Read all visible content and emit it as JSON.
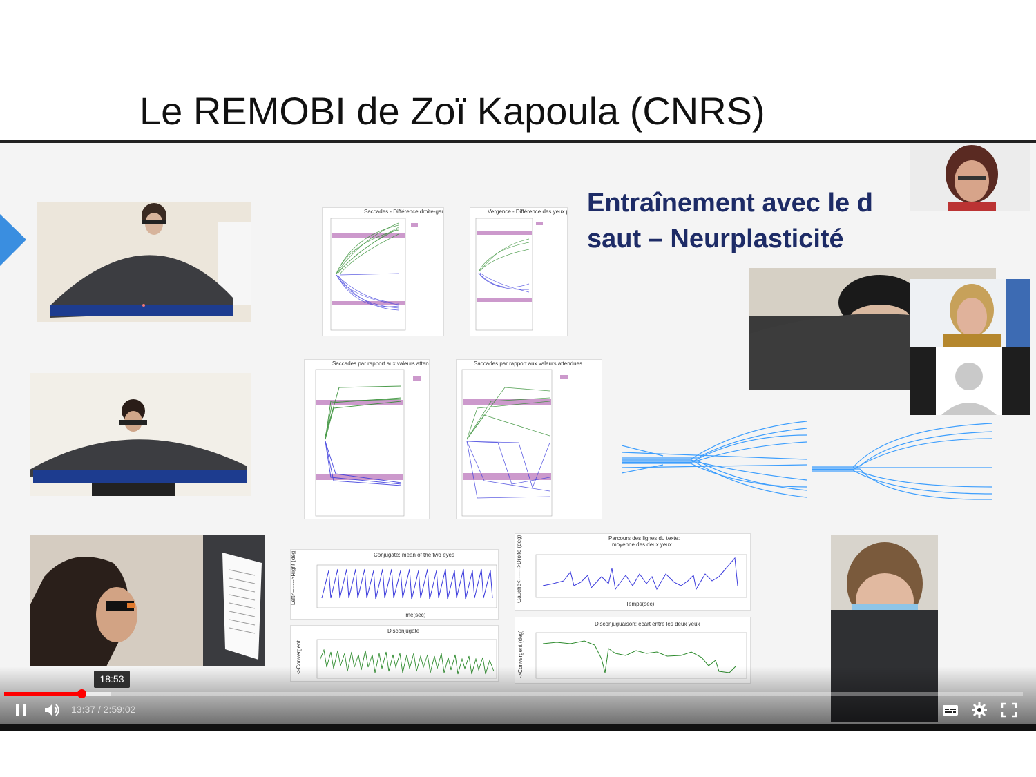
{
  "slide": {
    "title": "Le REMOBI de Zoï Kapoula (CNRS)"
  },
  "inner_slide": {
    "title_line1": "Entraînement avec le d",
    "title_line2": "saut – Neurplasticité",
    "plots": {
      "p1_title": "Saccades - Différence droite-gauche pour le rapport aux valeurs attendues",
      "p2_title": "Vergence - Différence des yeux pour le rapport aux valeurs attendues",
      "p3_title": "Saccades par rapport aux valeurs attendues",
      "p4_title": "Saccades par rapport aux valeurs attendues",
      "p5_title": "Conjugate: mean of the two eyes",
      "p5_xlabel": "Time(sec)",
      "p5_ylabel": "Left<------->Right (deg)",
      "p6_title": "Disconjugate",
      "p6_ylabel": "<-Convergent",
      "p7_title_line1": "Parcours des lignes du texte:",
      "p7_title_line2": "moyenne des deux yeux",
      "p7_xlabel": "Temps(sec)",
      "p7_ylabel": "Gauche<------->Droite (deg)",
      "p8_title": "Disconjuguaison: ecart entre les deux yeux",
      "p8_ylabel": "->Convergent (deg)"
    },
    "colors": {
      "green": "#2e8b2e",
      "blue": "#3a3adc",
      "pink": "#cc99cc",
      "traj_blue": "#1e90ff",
      "title_navy": "#1d2b66"
    }
  },
  "player": {
    "hover_time": "18:53",
    "current_time": "13:37",
    "separator": " / ",
    "duration": "2:59:02",
    "progress_fraction": 0.0761,
    "buffered_fraction": 0.105,
    "progress_color": "#ff0000",
    "icons": [
      "pause-icon",
      "volume-icon",
      "subtitles-icon",
      "settings-icon",
      "fullscreen-icon"
    ]
  },
  "participants": [
    "participant-video-woman-glasses",
    "participant-video-woman-blonde",
    "participant-avatar-placeholder",
    "participant-video-child"
  ]
}
